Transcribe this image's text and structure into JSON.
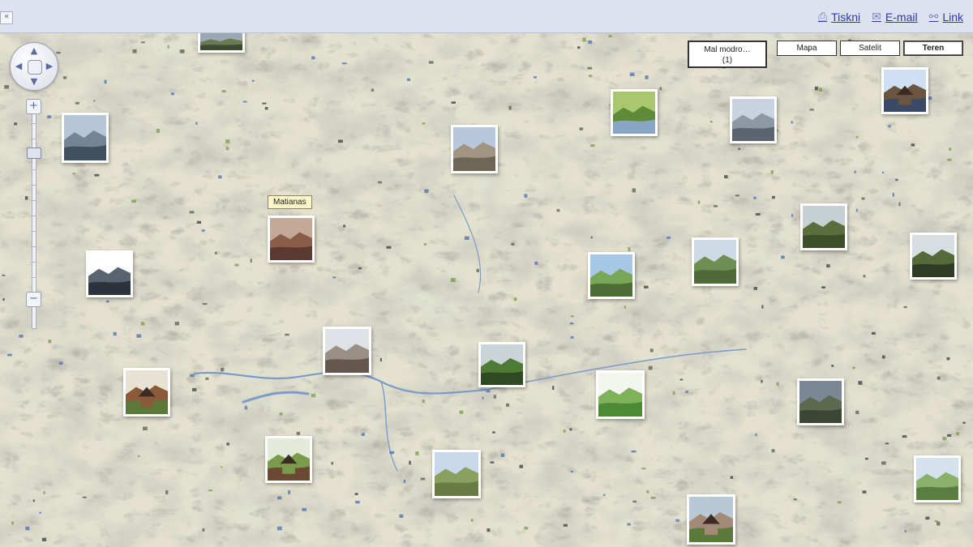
{
  "topbar": {
    "collapse_glyph": "«",
    "links": [
      {
        "name": "print",
        "label": "Tiskni",
        "icon": "printer-icon",
        "glyph": "⎙"
      },
      {
        "name": "email",
        "label": "E-mail",
        "icon": "envelope-icon",
        "glyph": "✉"
      },
      {
        "name": "link",
        "label": "Link",
        "icon": "link-icon",
        "glyph": "⚯"
      }
    ]
  },
  "controls": {
    "pan": {
      "up": "▲",
      "down": "▼",
      "left": "◀",
      "right": "▶"
    },
    "zoom": {
      "in": "+",
      "out": "−",
      "level": 0.2
    },
    "location_box": {
      "line1": "Mal modro…",
      "line2": "(1)"
    },
    "map_types": [
      {
        "label": "Mapa",
        "active": false
      },
      {
        "label": "Satelit",
        "active": false
      },
      {
        "label": "Teren",
        "active": true
      }
    ]
  },
  "place_label": "Matianas",
  "colors": {
    "map_base": "#e6e3d2",
    "relief_dark": "#8f8d7d",
    "water": "#7d9bc9",
    "link_blue": "#2a3aa8",
    "topbar_bg": "#dde2ee"
  },
  "photos": [
    {
      "name": "house",
      "palette": [
        "#cfe0f4",
        "#6b5540",
        "#3a4a66"
      ]
    },
    {
      "name": "meadow-river",
      "palette": [
        "#a9c86e",
        "#5e8a3a",
        "#88a6c4"
      ]
    },
    {
      "name": "misty-lake",
      "palette": [
        "#c9d3de",
        "#8e98a4",
        "#5b6570"
      ]
    },
    {
      "name": "mountain-fog",
      "palette": [
        "#b7c6d6",
        "#728496",
        "#41505e"
      ]
    },
    {
      "name": "village-plain",
      "palette": [
        "#b8c7dc",
        "#a19480",
        "#6e6656"
      ]
    },
    {
      "name": "rock-ruins",
      "palette": [
        "#c4a898",
        "#8a5c4a",
        "#5a3a30"
      ]
    },
    {
      "name": "forest-slope",
      "palette": [
        "#c6cfd4",
        "#5a6d3c",
        "#3e4e2a"
      ]
    },
    {
      "name": "valley-river",
      "palette": [
        "#cdd9e4",
        "#6f8e52",
        "#4e6a3a"
      ]
    },
    {
      "name": "dark-hill",
      "palette": [
        "#d8dde2",
        "#556a3a",
        "#2e3b22"
      ]
    },
    {
      "name": "waterfall",
      "palette": [
        "#ffffff",
        "#5a6470",
        "#2c333a"
      ]
    },
    {
      "name": "pasture",
      "palette": [
        "#a8c6e6",
        "#7aa658",
        "#4c6e34"
      ]
    },
    {
      "name": "town-roofs",
      "palette": [
        "#dfe3e8",
        "#9a8f86",
        "#63574e"
      ]
    },
    {
      "name": "green-field",
      "palette": [
        "#c9d4d8",
        "#4f7a36",
        "#2f4a22"
      ]
    },
    {
      "name": "bright-slope",
      "palette": [
        "#f2f6ee",
        "#7fb05a",
        "#4c8a36"
      ]
    },
    {
      "name": "hut-meadow",
      "palette": [
        "#e8e2d4",
        "#8b5a3a",
        "#5b7a3a"
      ]
    },
    {
      "name": "stormy-field",
      "palette": [
        "#7a8896",
        "#5e6a50",
        "#3c4634"
      ]
    },
    {
      "name": "farm-house",
      "palette": [
        "#e4ead8",
        "#7a9a4c",
        "#6a4a32"
      ]
    },
    {
      "name": "open-field",
      "palette": [
        "#c8d8ea",
        "#8aa05e",
        "#6a7a44"
      ]
    },
    {
      "name": "cottage-green",
      "palette": [
        "#b8c8d6",
        "#a38a76",
        "#5a7a3a"
      ]
    },
    {
      "name": "green-hills",
      "palette": [
        "#d4e2ee",
        "#8ab06a",
        "#5a7e42"
      ]
    },
    {
      "name": "cliff-top",
      "palette": [
        "#9aa8b4",
        "#6a7a52",
        "#3a4a2e"
      ]
    }
  ]
}
